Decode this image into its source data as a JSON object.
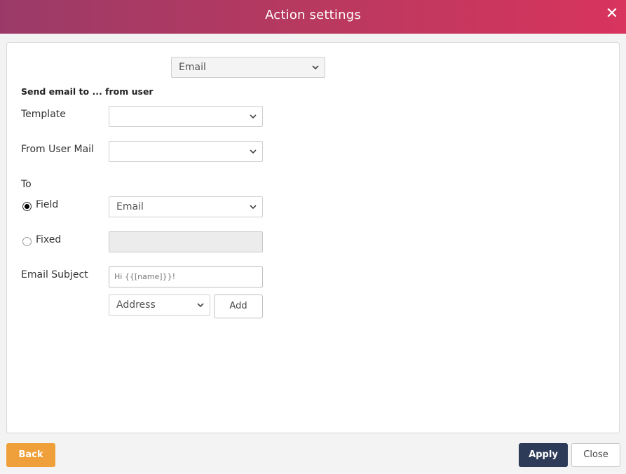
{
  "window": {
    "title": "Action settings"
  },
  "action_type": {
    "selected": "Email"
  },
  "section": {
    "heading": "Send email to ... from user"
  },
  "template": {
    "label": "Template",
    "selected": ""
  },
  "from_user_mail": {
    "label": "From User Mail",
    "selected": ""
  },
  "to": {
    "label": "To",
    "field_label": "Field",
    "field_selected": "Email",
    "field_checked": true,
    "fixed_label": "Fixed",
    "fixed_value": ""
  },
  "email_subject": {
    "label": "Email Subject",
    "value": "Hi {{[name]}}!",
    "insert_field_selected": "Address",
    "add_label": "Add"
  },
  "footer": {
    "back_label": "Back",
    "apply_label": "Apply",
    "close_label": "Close"
  },
  "colors": {
    "back": "#f0a03a",
    "apply": "#2e3b58",
    "header_start": "#9b3a68",
    "header_end": "#d8345e"
  }
}
